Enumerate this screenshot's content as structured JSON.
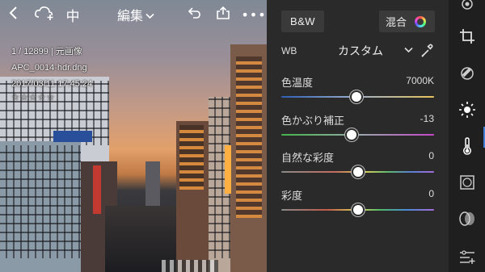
{
  "toolbar": {
    "back_icon": "chevron-left-icon",
    "cloud_icon": "cloud-add-icon",
    "compare_glyph": "中",
    "edit_menu_label": "編集",
    "undo_icon": "undo-icon",
    "share_icon": "share-icon",
    "more_glyph": "•••"
  },
  "photo_info": {
    "index": "1 / 12899 | 元画像",
    "filename": "APC_0014-hdr.dng",
    "datetime": "2017/03/11 17:45:24",
    "rating_stars": "☆☆☆☆☆"
  },
  "panel": {
    "bw_label": "B&W",
    "mix_label": "混合",
    "wb": {
      "label": "WB",
      "value": "カスタム"
    },
    "sliders": [
      {
        "label": "色温度",
        "value": "7000K",
        "position": 0.49
      },
      {
        "label": "色かぶり補正",
        "value": "-13",
        "position": 0.46
      },
      {
        "label": "自然な彩度",
        "value": "0",
        "position": 0.5
      },
      {
        "label": "彩度",
        "value": "0",
        "position": 0.5
      }
    ]
  },
  "rail": {
    "icons": [
      "radial-icon",
      "crop-icon",
      "heal-icon",
      "light-icon",
      "color-temp-icon",
      "vignette-icon",
      "detail-icon",
      "presets-icon"
    ]
  },
  "colors": {
    "accent": "#3f7fd6",
    "panel_bg": "#2a2a2a",
    "rail_bg": "#1f1f1f"
  }
}
